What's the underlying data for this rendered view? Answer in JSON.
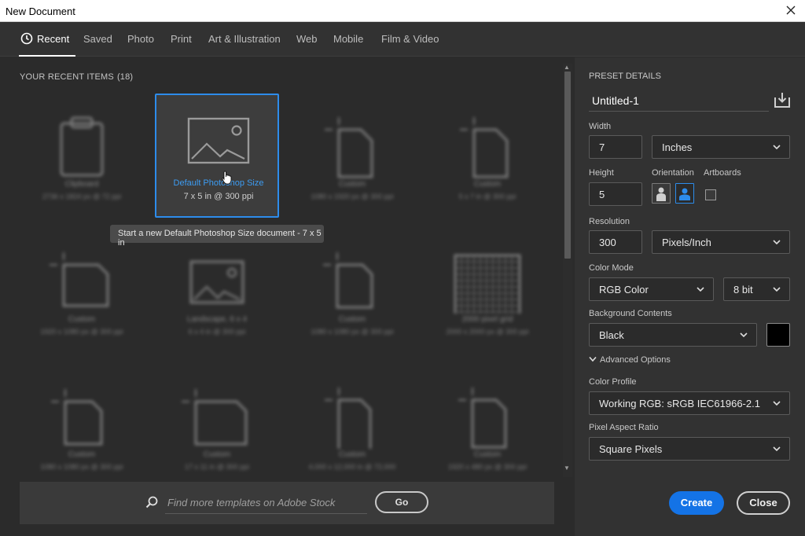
{
  "window": {
    "title": "New Document"
  },
  "tabs": [
    {
      "label": "Recent",
      "active": true
    },
    {
      "label": "Saved"
    },
    {
      "label": "Photo"
    },
    {
      "label": "Print"
    },
    {
      "label": "Art & Illustration"
    },
    {
      "label": "Web"
    },
    {
      "label": "Mobile"
    },
    {
      "label": "Film & Video"
    }
  ],
  "recent": {
    "title": "YOUR RECENT ITEMS",
    "count": "(18)",
    "items": [
      {
        "name": "Clipboard",
        "meta": "2736 x 1824 px @ 72 ppi",
        "icon": "clipboard-icon"
      },
      {
        "name": "Default Photoshop Size",
        "meta": "7 x 5 in @ 300 ppi",
        "icon": "landscape-image-icon",
        "selected": true
      },
      {
        "name": "Custom",
        "meta": "1080 x 1920 px @ 300 ppi",
        "icon": "document-icon"
      },
      {
        "name": "Custom",
        "meta": "5 x 7 in @ 300 ppi",
        "icon": "document-icon"
      },
      {
        "name": "Custom",
        "meta": "1920 x 1080 px @ 300 ppi",
        "icon": "document-landscape-icon"
      },
      {
        "name": "Landscape, 6 x 4",
        "meta": "6 x 4 in @ 300 ppi",
        "icon": "landscape-image-icon"
      },
      {
        "name": "Custom",
        "meta": "1080 x 1080 px @ 300 ppi",
        "icon": "document-icon"
      },
      {
        "name": "2000 pixel grid",
        "meta": "2000 x 2000 px @ 300 ppi",
        "icon": "grid-icon"
      },
      {
        "name": "Custom",
        "meta": "1080 x 1080 px @ 300 ppi",
        "icon": "document-icon"
      },
      {
        "name": "Custom",
        "meta": "17 x 11 in @ 300 ppi",
        "icon": "document-landscape-icon"
      },
      {
        "name": "Custom",
        "meta": "4,000 x 12,000 in @ 72,000",
        "icon": "document-icon"
      },
      {
        "name": "Custom",
        "meta": "1920 x 480 px @ 300 ppi",
        "icon": "document-icon"
      }
    ],
    "tooltip": "Start a new Default Photoshop Size document - 7 x 5 in"
  },
  "stock": {
    "placeholder": "Find more templates on Adobe Stock",
    "go_label": "Go"
  },
  "preset": {
    "title": "PRESET DETAILS",
    "doc_name": "Untitled-1",
    "width_label": "Width",
    "width_value": "7",
    "width_unit": "Inches",
    "height_label": "Height",
    "height_value": "5",
    "orientation_label": "Orientation",
    "artboards_label": "Artboards",
    "resolution_label": "Resolution",
    "resolution_value": "300",
    "resolution_unit": "Pixels/Inch",
    "color_mode_label": "Color Mode",
    "color_mode_value": "RGB Color",
    "bit_depth": "8 bit",
    "background_label": "Background Contents",
    "background_value": "Black",
    "background_color": "#000000",
    "advanced_label": "Advanced Options",
    "color_profile_label": "Color Profile",
    "color_profile_value": "Working RGB: sRGB IEC61966-2.1",
    "pixel_aspect_label": "Pixel Aspect Ratio",
    "pixel_aspect_value": "Square Pixels",
    "create_label": "Create",
    "close_label": "Close"
  },
  "colors": {
    "accent": "#1473e6",
    "selection": "#2d8ceb"
  }
}
